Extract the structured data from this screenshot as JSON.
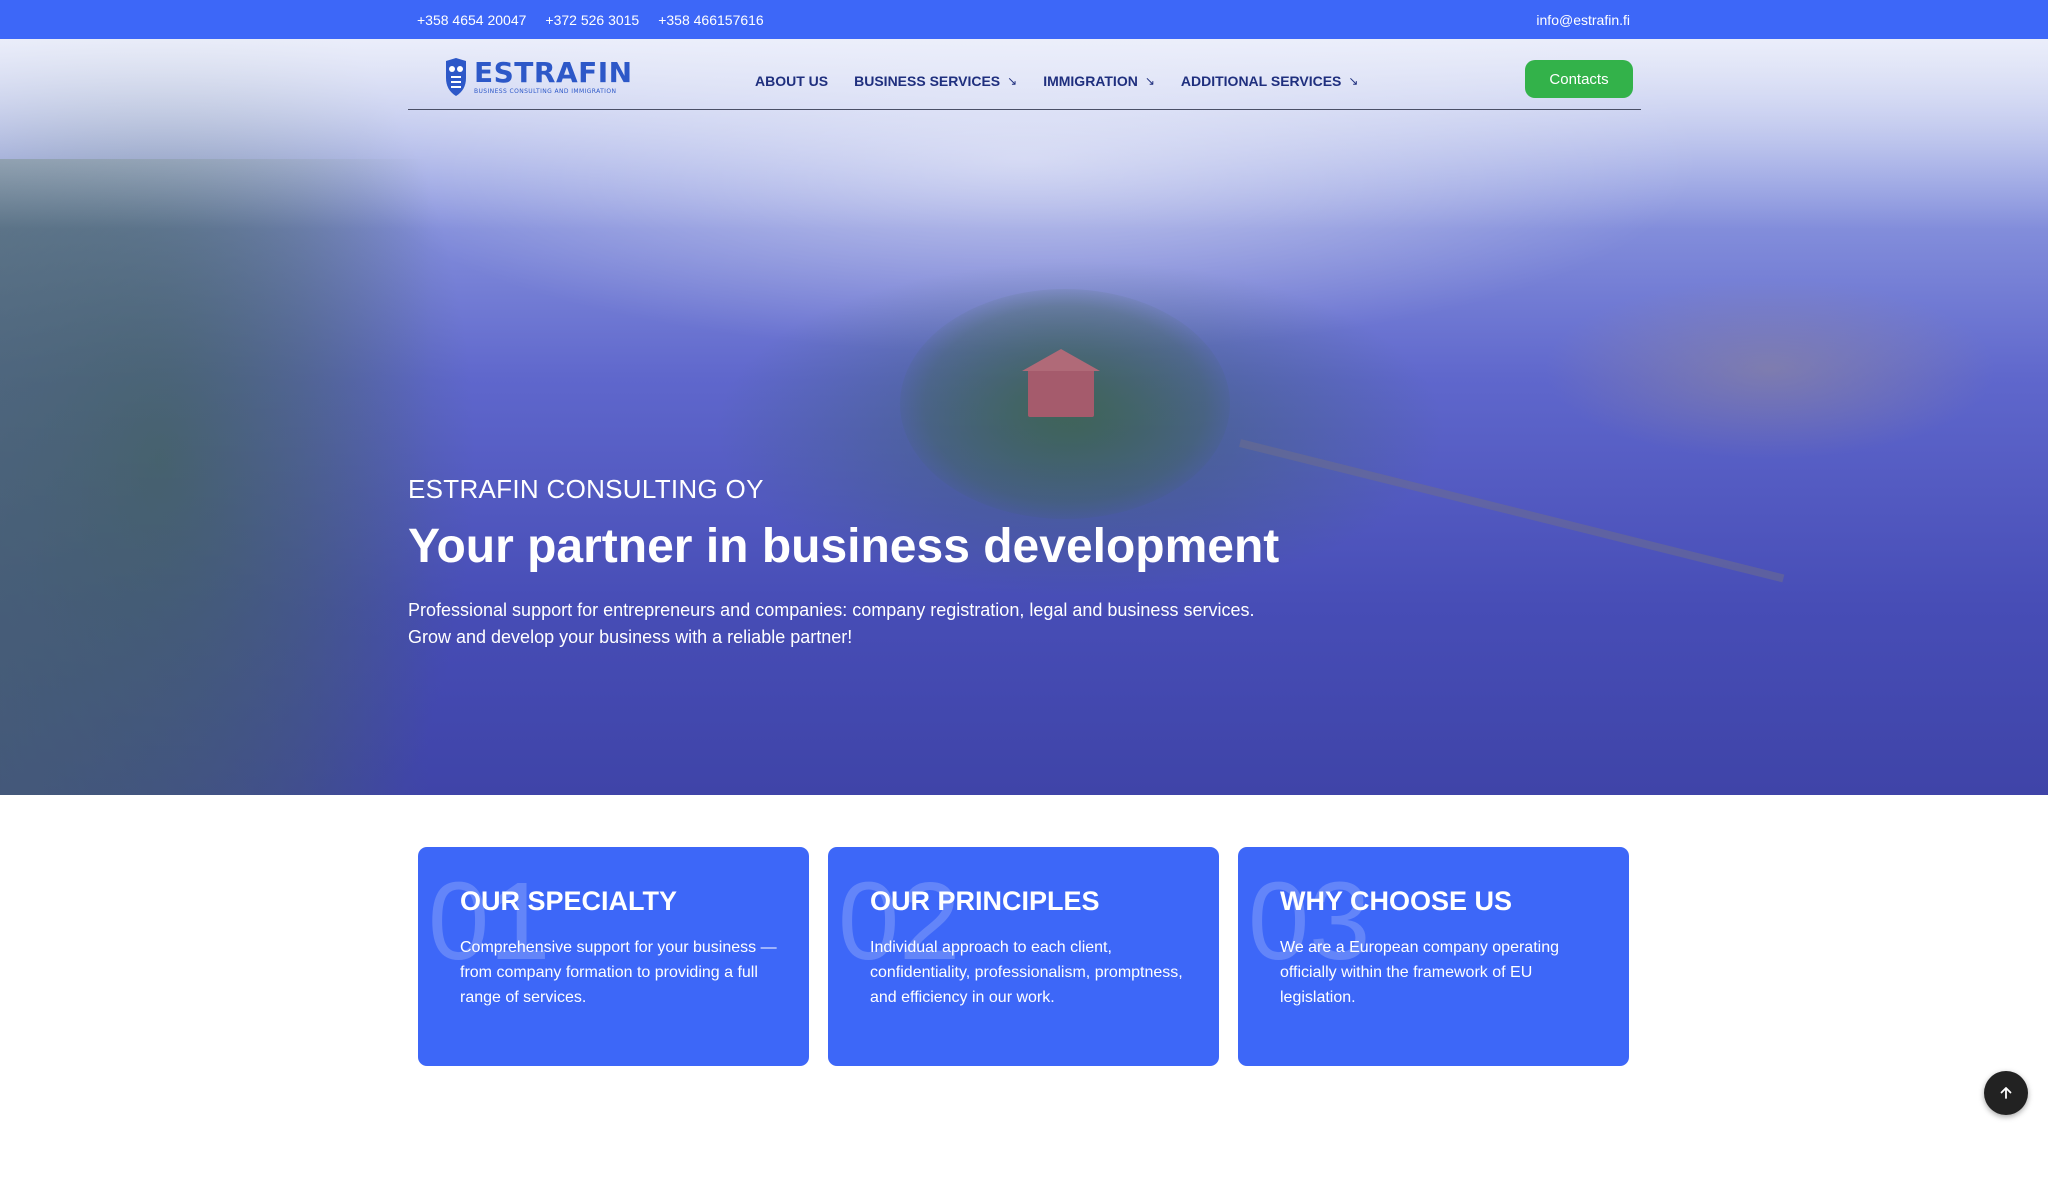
{
  "topbar": {
    "phones": [
      "+358 4654 20047",
      "+372 526 3015",
      "+358 466157616"
    ],
    "email": "info@estrafin.fi"
  },
  "header": {
    "logo": {
      "name": "ESTRAFIN",
      "tagline": "BUSINESS CONSULTING AND IMMIGRATION"
    },
    "nav": [
      {
        "label": "ABOUT US",
        "has_dropdown": false
      },
      {
        "label": "BUSINESS SERVICES",
        "has_dropdown": true
      },
      {
        "label": "IMMIGRATION",
        "has_dropdown": true
      },
      {
        "label": "ADDITIONAL SERVICES",
        "has_dropdown": true
      }
    ],
    "dropdown_icon": "arrow-down-right-icon",
    "contacts_label": "Contacts"
  },
  "hero": {
    "eyebrow": "ESTRAFIN CONSULTING OY",
    "title": "Your partner in business development",
    "description_line1": "Professional support for entrepreneurs and companies: company registration, legal and business services.",
    "description_line2": "Grow and develop your business with a reliable partner!"
  },
  "cards": [
    {
      "number": "01",
      "title": "OUR SPECIALTY",
      "text": "Comprehensive support for your business — from company formation to providing a full range of services."
    },
    {
      "number": "02",
      "title": "OUR PRINCIPLES",
      "text": "Individual approach to each client, confidentiality, professionalism, promptness, and efficiency in our work."
    },
    {
      "number": "03",
      "title": "WHY CHOOSE US",
      "text": "We are a European company operating officially within the framework of EU legislation."
    }
  ],
  "scroll_top": {
    "icon": "arrow-up-icon"
  },
  "colors": {
    "topbar": "#3d67f8",
    "card": "#3d67f8",
    "nav_text": "#1f2f7e",
    "contacts_button": "#33b24a",
    "logo": "#2d58c8"
  }
}
